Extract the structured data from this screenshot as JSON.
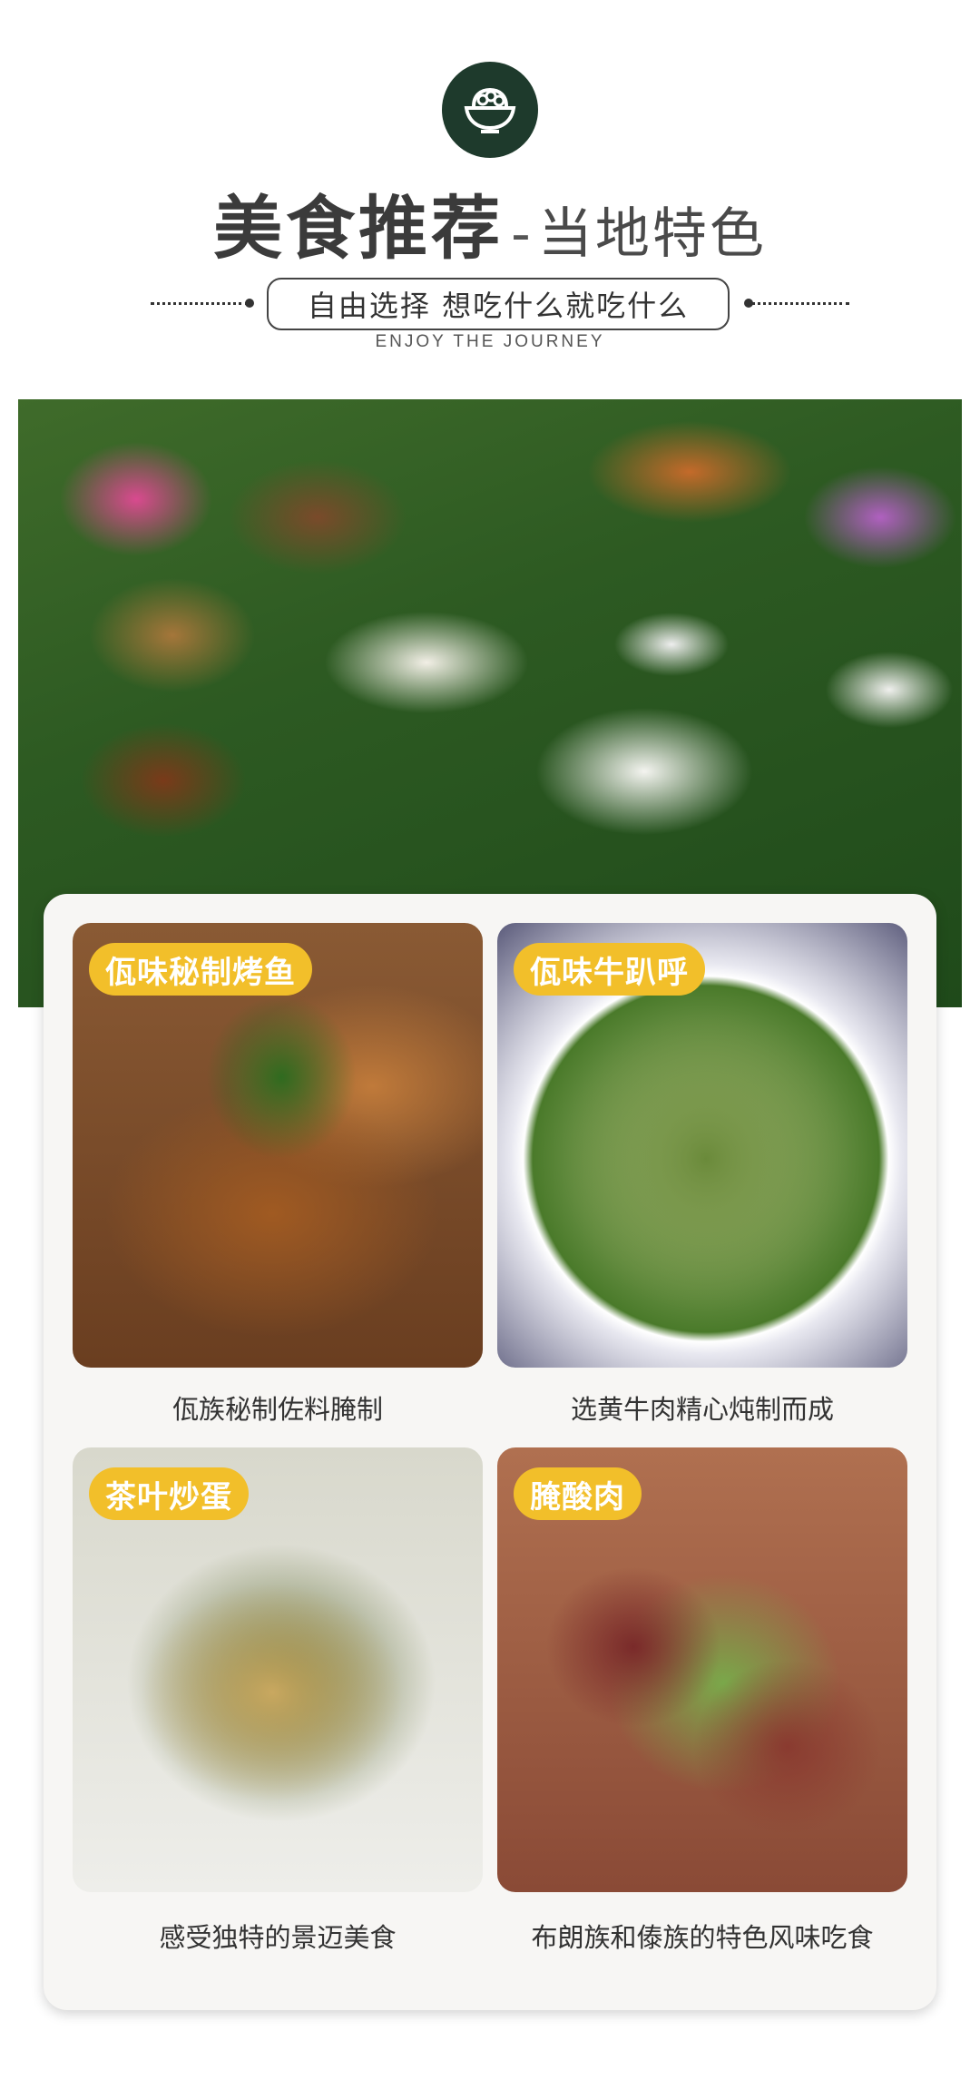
{
  "header": {
    "title_main": "美食推荐",
    "title_dash": "-",
    "title_sub": "当地特色",
    "slogan": "自由选择  想吃什么就吃什么",
    "english": "ENJOY THE JOURNEY",
    "logo_icon": "rice-bowl-icon"
  },
  "colors": {
    "logo_bg": "#1e3a2c",
    "tag_bg": "#f2bf2a",
    "card_bg": "#f7f6f4"
  },
  "banner": {
    "image": "buffet-table-photo"
  },
  "dishes": [
    {
      "tag": "佤味秘制烤鱼",
      "caption": "佤族秘制佐料腌制",
      "image": "grilled-fish-photo"
    },
    {
      "tag": "佤味牛趴呼",
      "caption": "选黄牛肉精心炖制而成",
      "image": "beef-salad-photo"
    },
    {
      "tag": "茶叶炒蛋",
      "caption": "感受独特的景迈美食",
      "image": "tea-leaf-egg-photo"
    },
    {
      "tag": "腌酸肉",
      "caption": "布朗族和傣族的特色风味吃食",
      "image": "pickled-pork-photo"
    }
  ]
}
